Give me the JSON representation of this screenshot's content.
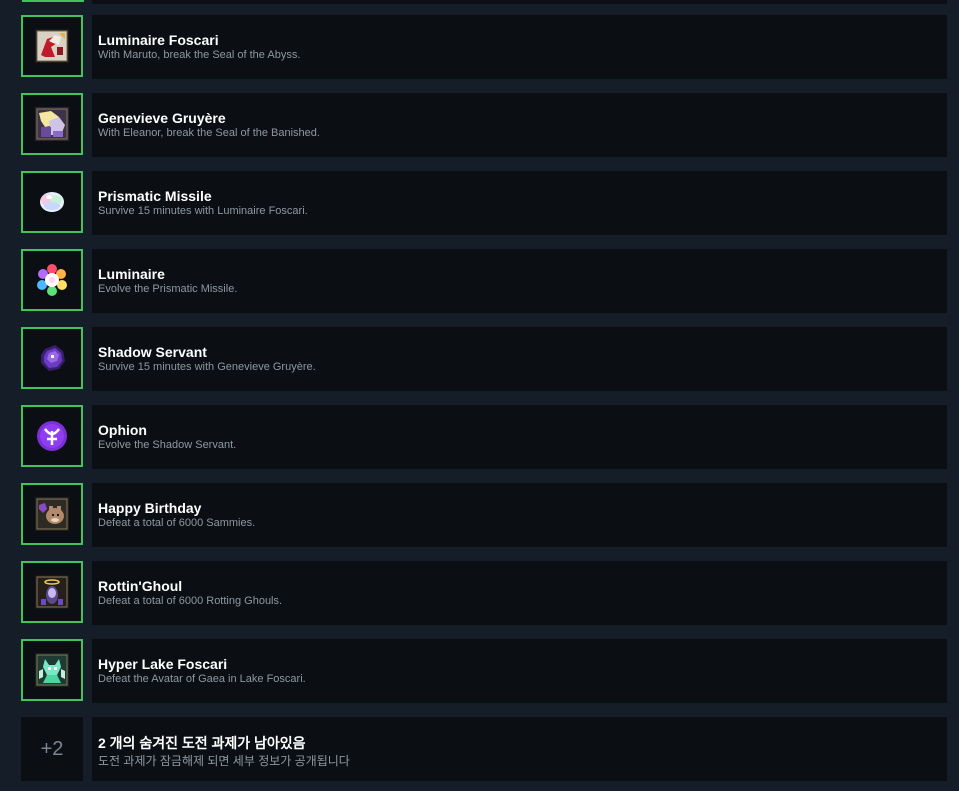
{
  "achievements": [
    {
      "title": "Luminaire Foscari",
      "description": "With Maruto, break the Seal of the Abyss.",
      "icon": "foscari-knight-icon"
    },
    {
      "title": "Genevieve Gruyère",
      "description": "With Eleanor, break the Seal of the Banished.",
      "icon": "genevieve-portrait-icon"
    },
    {
      "title": "Prismatic Missile",
      "description": "Survive 15 minutes with Luminaire Foscari.",
      "icon": "prismatic-orb-icon"
    },
    {
      "title": "Luminaire",
      "description": "Evolve the Prismatic Missile.",
      "icon": "rainbow-flower-icon"
    },
    {
      "title": "Shadow Servant",
      "description": "Survive 15 minutes with Genevieve Gruyère.",
      "icon": "shadow-servant-icon"
    },
    {
      "title": "Ophion",
      "description": "Evolve the Shadow Servant.",
      "icon": "ophion-sigil-icon"
    },
    {
      "title": "Happy Birthday",
      "description": "Defeat a total of 6000 Sammies.",
      "icon": "sammy-icon"
    },
    {
      "title": "Rottin'Ghoul",
      "description": "Defeat a total of 6000 Rotting Ghouls.",
      "icon": "ghoul-halo-icon"
    },
    {
      "title": "Hyper Lake Foscari",
      "description": "Defeat the Avatar of Gaea in Lake Foscari.",
      "icon": "gaea-avatar-icon"
    }
  ],
  "hidden": {
    "count_label": "+2",
    "title": "2 개의 숨겨진 도전 과제가 남아있음",
    "description": "도전 과제가 잠금해제 되면 세부 정보가 공개됩니다"
  },
  "colors": {
    "background": "#141d28",
    "panel": "#0b0f14",
    "unlocked_border": "#3fc35a",
    "title_text": "#ffffff",
    "description_text": "#8f98a0"
  }
}
